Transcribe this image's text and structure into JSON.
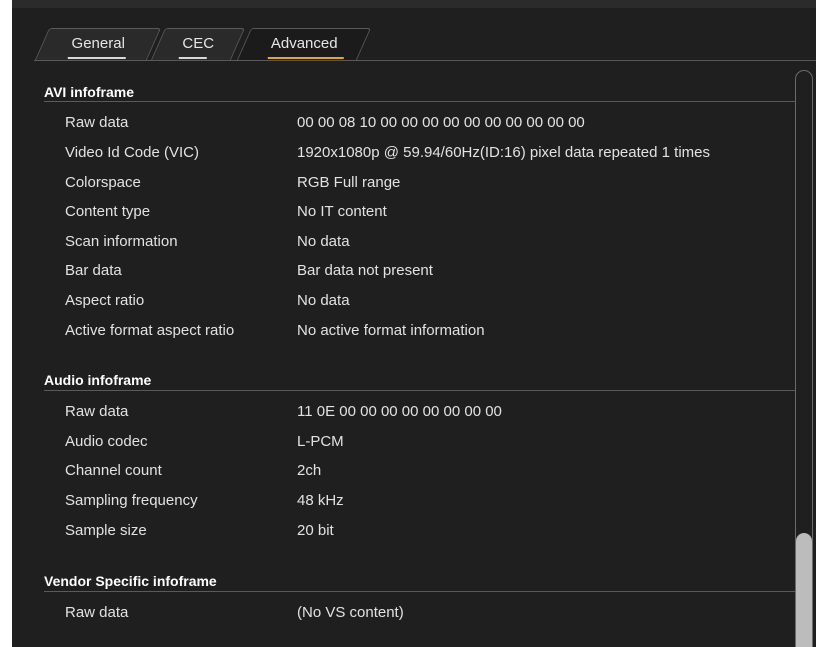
{
  "tabs": [
    {
      "label": "General"
    },
    {
      "label": "CEC"
    },
    {
      "label": "Advanced"
    }
  ],
  "active_tab": "Advanced",
  "colors": {
    "accent": "#e2a634",
    "tab_underline": "#d9d9d9",
    "background": "#1f1f1f"
  },
  "sections": {
    "avi": {
      "title": "AVI infoframe",
      "rows": [
        {
          "label": "Raw data",
          "value": "00 00 08 10 00 00 00 00 00 00 00 00 00 00"
        },
        {
          "label": "Video Id Code (VIC)",
          "value": "1920x1080p @ 59.94/60Hz(ID:16) pixel data repeated 1 times"
        },
        {
          "label": "Colorspace",
          "value": "RGB Full range"
        },
        {
          "label": "Content type",
          "value": "No IT content"
        },
        {
          "label": "Scan information",
          "value": "No data"
        },
        {
          "label": "Bar data",
          "value": "Bar data not present"
        },
        {
          "label": "Aspect ratio",
          "value": "No data"
        },
        {
          "label": "Active format aspect ratio",
          "value": "No active format information"
        }
      ]
    },
    "audio": {
      "title": "Audio infoframe",
      "rows": [
        {
          "label": "Raw data",
          "value": "11 0E 00 00 00 00 00 00 00 00"
        },
        {
          "label": "Audio codec",
          "value": "L-PCM"
        },
        {
          "label": "Channel count",
          "value": "2ch"
        },
        {
          "label": "Sampling frequency",
          "value": "48 kHz"
        },
        {
          "label": "Sample size",
          "value": "20 bit"
        }
      ]
    },
    "vendor": {
      "title": "Vendor Specific infoframe",
      "rows": [
        {
          "label": "Raw data",
          "value": "(No VS content)"
        }
      ]
    }
  }
}
